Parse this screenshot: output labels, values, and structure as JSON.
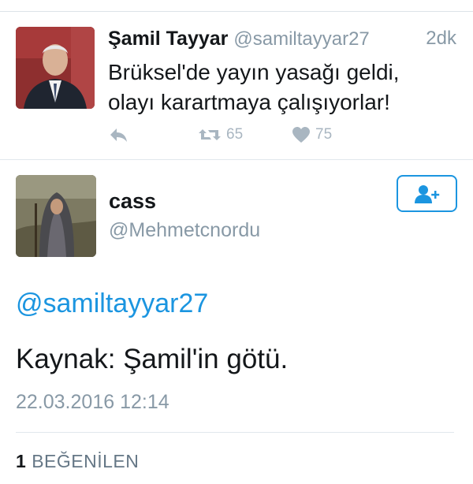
{
  "tweet1": {
    "author_name": "Şamil Tayyar",
    "author_handle": "@samiltayyar27",
    "time": "2dk",
    "text_line1": "Brüksel'de yayın yasağı geldi,",
    "text_line2": "olayı karartmaya çalışıyorlar!",
    "retweet_count": "65",
    "like_count": "75",
    "icons": {
      "reply": "reply-icon",
      "retweet": "retweet-icon",
      "like": "heart-icon"
    }
  },
  "tweet2": {
    "author_name": "cass",
    "author_handle": "@Mehmetcnordu",
    "mention": "@samiltayyar27",
    "text": "Kaynak: Şamil'in götü.",
    "date": "22.03.2016 12:14",
    "follow_icon": "follow-user-icon"
  },
  "likes": {
    "count": "1",
    "label": "BEĞENİLEN"
  },
  "colors": {
    "accent": "#1b95e0",
    "muted": "#8899a6",
    "action_gray": "#a9b6c1",
    "divider": "#e1e8ed"
  }
}
